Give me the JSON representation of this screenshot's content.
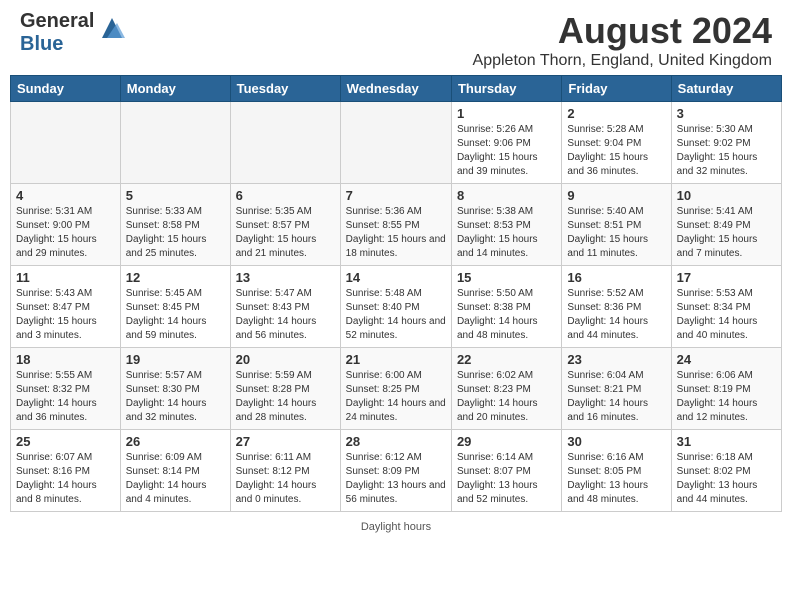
{
  "header": {
    "logo_general": "General",
    "logo_blue": "Blue",
    "main_title": "August 2024",
    "subtitle": "Appleton Thorn, England, United Kingdom"
  },
  "columns": [
    "Sunday",
    "Monday",
    "Tuesday",
    "Wednesday",
    "Thursday",
    "Friday",
    "Saturday"
  ],
  "weeks": [
    [
      {
        "day": "",
        "empty": true
      },
      {
        "day": "",
        "empty": true
      },
      {
        "day": "",
        "empty": true
      },
      {
        "day": "",
        "empty": true
      },
      {
        "day": "1",
        "rise": "5:26 AM",
        "set": "9:06 PM",
        "daylight": "15 hours and 39 minutes."
      },
      {
        "day": "2",
        "rise": "5:28 AM",
        "set": "9:04 PM",
        "daylight": "15 hours and 36 minutes."
      },
      {
        "day": "3",
        "rise": "5:30 AM",
        "set": "9:02 PM",
        "daylight": "15 hours and 32 minutes."
      }
    ],
    [
      {
        "day": "4",
        "rise": "5:31 AM",
        "set": "9:00 PM",
        "daylight": "15 hours and 29 minutes."
      },
      {
        "day": "5",
        "rise": "5:33 AM",
        "set": "8:58 PM",
        "daylight": "15 hours and 25 minutes."
      },
      {
        "day": "6",
        "rise": "5:35 AM",
        "set": "8:57 PM",
        "daylight": "15 hours and 21 minutes."
      },
      {
        "day": "7",
        "rise": "5:36 AM",
        "set": "8:55 PM",
        "daylight": "15 hours and 18 minutes."
      },
      {
        "day": "8",
        "rise": "5:38 AM",
        "set": "8:53 PM",
        "daylight": "15 hours and 14 minutes."
      },
      {
        "day": "9",
        "rise": "5:40 AM",
        "set": "8:51 PM",
        "daylight": "15 hours and 11 minutes."
      },
      {
        "day": "10",
        "rise": "5:41 AM",
        "set": "8:49 PM",
        "daylight": "15 hours and 7 minutes."
      }
    ],
    [
      {
        "day": "11",
        "rise": "5:43 AM",
        "set": "8:47 PM",
        "daylight": "15 hours and 3 minutes."
      },
      {
        "day": "12",
        "rise": "5:45 AM",
        "set": "8:45 PM",
        "daylight": "14 hours and 59 minutes."
      },
      {
        "day": "13",
        "rise": "5:47 AM",
        "set": "8:43 PM",
        "daylight": "14 hours and 56 minutes."
      },
      {
        "day": "14",
        "rise": "5:48 AM",
        "set": "8:40 PM",
        "daylight": "14 hours and 52 minutes."
      },
      {
        "day": "15",
        "rise": "5:50 AM",
        "set": "8:38 PM",
        "daylight": "14 hours and 48 minutes."
      },
      {
        "day": "16",
        "rise": "5:52 AM",
        "set": "8:36 PM",
        "daylight": "14 hours and 44 minutes."
      },
      {
        "day": "17",
        "rise": "5:53 AM",
        "set": "8:34 PM",
        "daylight": "14 hours and 40 minutes."
      }
    ],
    [
      {
        "day": "18",
        "rise": "5:55 AM",
        "set": "8:32 PM",
        "daylight": "14 hours and 36 minutes."
      },
      {
        "day": "19",
        "rise": "5:57 AM",
        "set": "8:30 PM",
        "daylight": "14 hours and 32 minutes."
      },
      {
        "day": "20",
        "rise": "5:59 AM",
        "set": "8:28 PM",
        "daylight": "14 hours and 28 minutes."
      },
      {
        "day": "21",
        "rise": "6:00 AM",
        "set": "8:25 PM",
        "daylight": "14 hours and 24 minutes."
      },
      {
        "day": "22",
        "rise": "6:02 AM",
        "set": "8:23 PM",
        "daylight": "14 hours and 20 minutes."
      },
      {
        "day": "23",
        "rise": "6:04 AM",
        "set": "8:21 PM",
        "daylight": "14 hours and 16 minutes."
      },
      {
        "day": "24",
        "rise": "6:06 AM",
        "set": "8:19 PM",
        "daylight": "14 hours and 12 minutes."
      }
    ],
    [
      {
        "day": "25",
        "rise": "6:07 AM",
        "set": "8:16 PM",
        "daylight": "14 hours and 8 minutes."
      },
      {
        "day": "26",
        "rise": "6:09 AM",
        "set": "8:14 PM",
        "daylight": "14 hours and 4 minutes."
      },
      {
        "day": "27",
        "rise": "6:11 AM",
        "set": "8:12 PM",
        "daylight": "14 hours and 0 minutes."
      },
      {
        "day": "28",
        "rise": "6:12 AM",
        "set": "8:09 PM",
        "daylight": "13 hours and 56 minutes."
      },
      {
        "day": "29",
        "rise": "6:14 AM",
        "set": "8:07 PM",
        "daylight": "13 hours and 52 minutes."
      },
      {
        "day": "30",
        "rise": "6:16 AM",
        "set": "8:05 PM",
        "daylight": "13 hours and 48 minutes."
      },
      {
        "day": "31",
        "rise": "6:18 AM",
        "set": "8:02 PM",
        "daylight": "13 hours and 44 minutes."
      }
    ]
  ],
  "footer": {
    "daylight_label": "Daylight hours"
  },
  "labels": {
    "sunrise": "Sunrise:",
    "sunset": "Sunset:",
    "daylight": "Daylight:"
  }
}
